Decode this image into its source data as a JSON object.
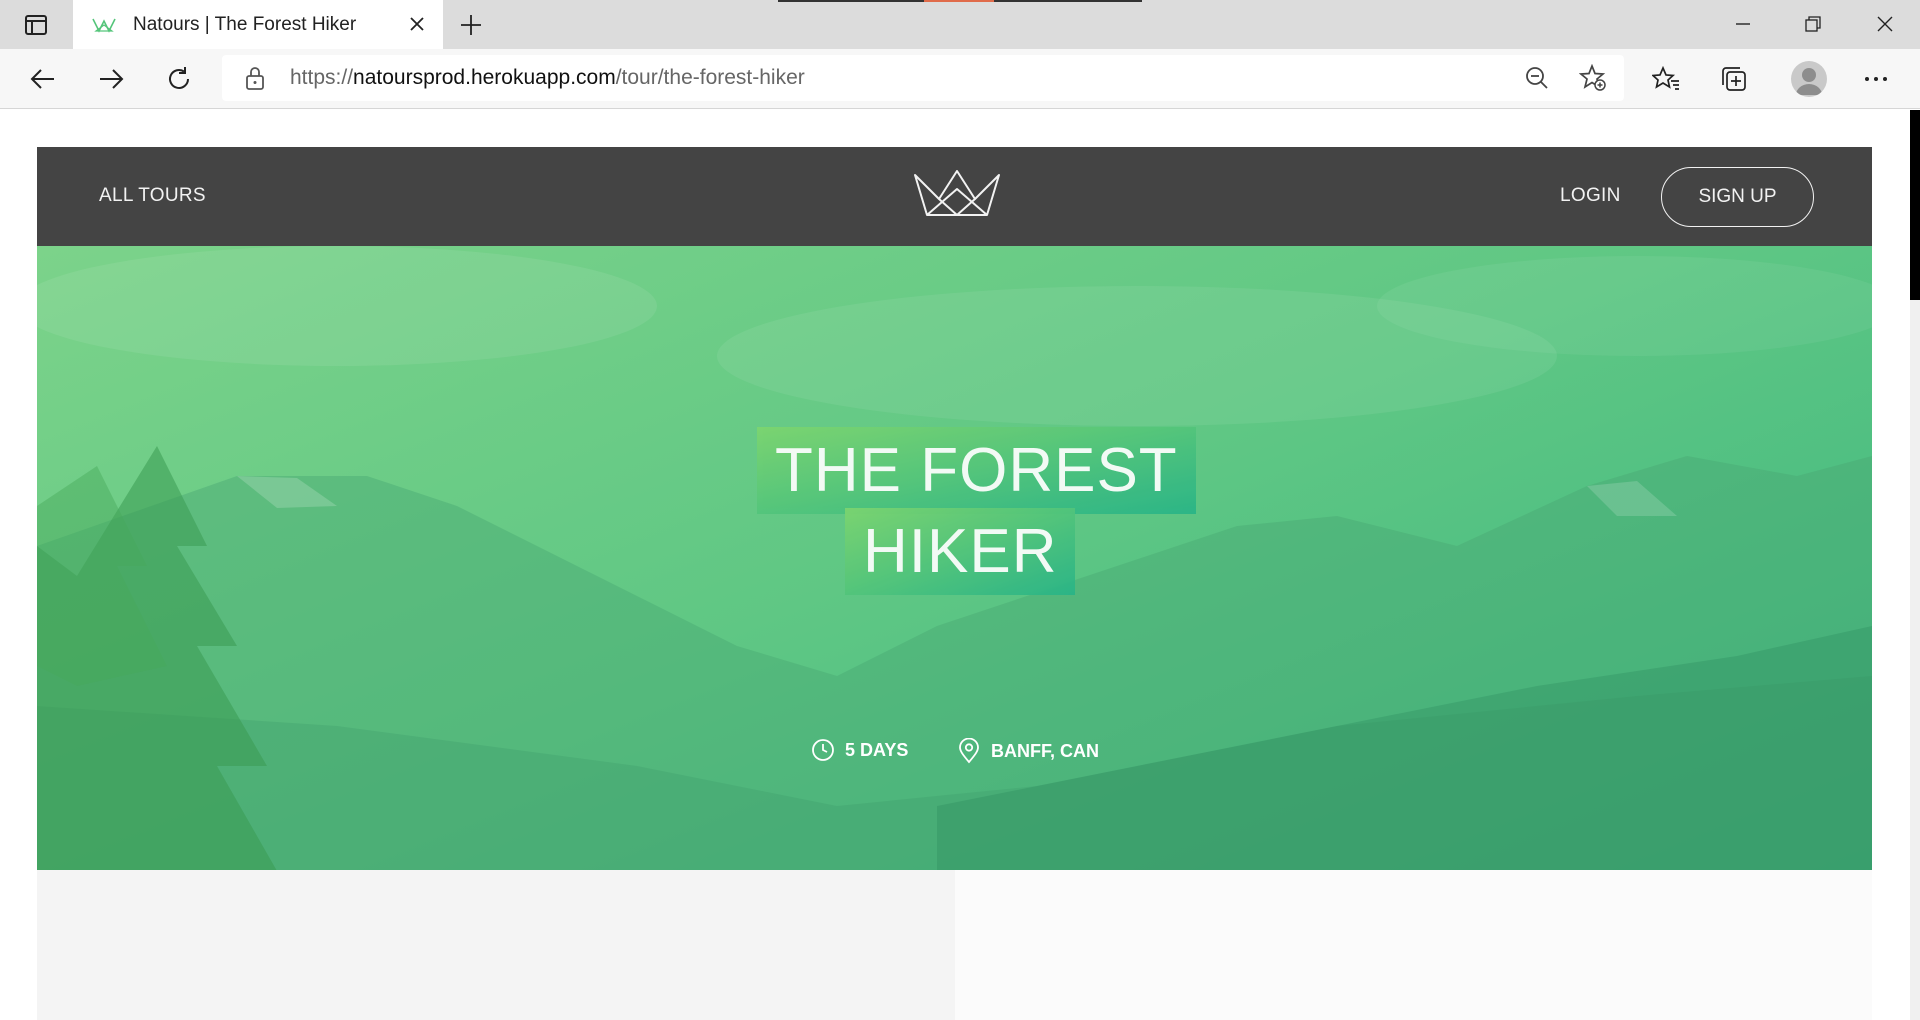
{
  "browser": {
    "tab_title": "Natours | The Forest Hiker",
    "url_scheme": "https://",
    "url_host": "natoursprod.herokuapp.com",
    "url_path": "/tour/the-forest-hiker"
  },
  "header": {
    "all_tours": "All tours",
    "login": "Login",
    "signup": "Sign up"
  },
  "tour": {
    "title_line1": "The forest",
    "title_line2": "hiker",
    "duration": "5 days",
    "location": "Banff, CAN"
  },
  "colors": {
    "header_bg": "#444444",
    "hero_gradient_start": "#7dd56f",
    "hero_gradient_end": "#28b487"
  }
}
